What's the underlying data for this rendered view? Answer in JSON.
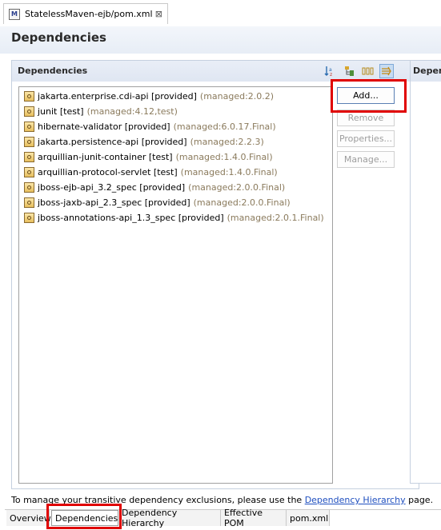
{
  "editor_tab": {
    "title": "StatelessMaven-ejb/pom.xml",
    "icon": "maven-file-icon",
    "close": "⊠"
  },
  "page": {
    "title": "Dependencies"
  },
  "section": {
    "title": "Dependencies",
    "toolbar": [
      {
        "name": "sort-alpha-icon",
        "glyph": "↓ᵃ"
      },
      {
        "name": "hierarchy-icon",
        "glyph": "⊢"
      },
      {
        "name": "columns-icon",
        "glyph": "▯▯▯"
      },
      {
        "name": "filter-icon",
        "glyph": "⇒"
      }
    ]
  },
  "section2": {
    "title": "Depen"
  },
  "dependencies": [
    {
      "name": "jakarta.enterprise.cdi-api [provided]",
      "managed": "(managed:2.0.2)"
    },
    {
      "name": "junit [test]",
      "managed": "(managed:4.12,test)"
    },
    {
      "name": "hibernate-validator [provided]",
      "managed": "(managed:6.0.17.Final)"
    },
    {
      "name": "jakarta.persistence-api [provided]",
      "managed": "(managed:2.2.3)"
    },
    {
      "name": "arquillian-junit-container [test]",
      "managed": "(managed:1.4.0.Final)"
    },
    {
      "name": "arquillian-protocol-servlet [test]",
      "managed": "(managed:1.4.0.Final)"
    },
    {
      "name": "jboss-ejb-api_3.2_spec [provided]",
      "managed": "(managed:2.0.0.Final)"
    },
    {
      "name": "jboss-jaxb-api_2.3_spec [provided]",
      "managed": "(managed:2.0.0.Final)"
    },
    {
      "name": "jboss-annotations-api_1.3_spec [provided]",
      "managed": "(managed:2.0.1.Final)"
    }
  ],
  "buttons": {
    "add": "Add...",
    "remove": "Remove",
    "properties": "Properties...",
    "manage": "Manage..."
  },
  "footer": {
    "prefix": "To manage your transitive dependency exclusions, please use the ",
    "link": "Dependency Hierarchy",
    "suffix": " page."
  },
  "bottom_tabs": [
    "Overview",
    "Dependencies",
    "Dependency Hierarchy",
    "Effective POM",
    "pom.xml"
  ],
  "colors": {
    "highlight": "#e00000",
    "link": "#1f4fbf",
    "managed_text": "#8a7a5c",
    "header_bg": "#dfe6f2"
  }
}
